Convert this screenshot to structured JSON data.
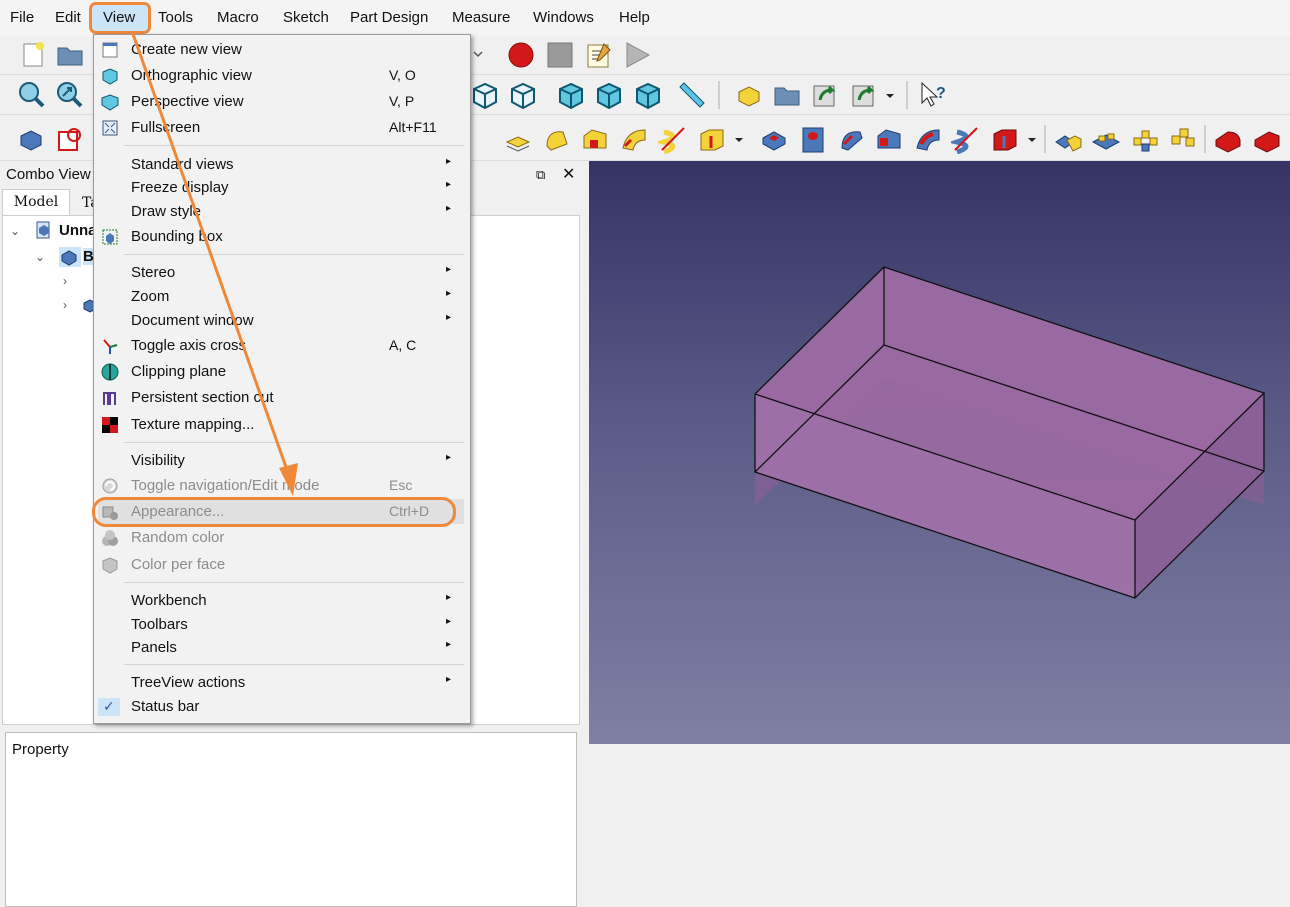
{
  "menubar": {
    "items": [
      "File",
      "Edit",
      "View",
      "Tools",
      "Macro",
      "Sketch",
      "Part Design",
      "Measure",
      "Windows",
      "Help"
    ],
    "active": "View"
  },
  "combo_view": {
    "title": "Combo View",
    "float_glyph": "⧉",
    "close_glyph": "✕",
    "tabs": [
      "Model",
      "Ta"
    ],
    "tree": [
      {
        "label": "Unna",
        "expanded": true
      },
      {
        "label": "B",
        "expanded": true
      }
    ],
    "property_header": "Property"
  },
  "view_menu": {
    "items": [
      {
        "label": "Create new view",
        "shortcut": "",
        "submenu": false,
        "enabled": true,
        "icon": "new-view-icon"
      },
      {
        "label": "Orthographic view",
        "shortcut": "V, O",
        "submenu": false,
        "enabled": true,
        "icon": "orthographic-cube-icon"
      },
      {
        "label": "Perspective view",
        "shortcut": "V, P",
        "submenu": false,
        "enabled": true,
        "icon": "perspective-cube-icon"
      },
      {
        "label": "Fullscreen",
        "shortcut": "Alt+F11",
        "submenu": false,
        "enabled": true,
        "icon": "fullscreen-icon"
      },
      {
        "label": "Standard views",
        "shortcut": "",
        "submenu": true,
        "enabled": true,
        "icon": ""
      },
      {
        "label": "Freeze display",
        "shortcut": "",
        "submenu": true,
        "enabled": true,
        "icon": ""
      },
      {
        "label": "Draw style",
        "shortcut": "",
        "submenu": true,
        "enabled": true,
        "icon": ""
      },
      {
        "label": "Bounding box",
        "shortcut": "",
        "submenu": false,
        "enabled": true,
        "icon": "bounding-box-icon"
      },
      {
        "label": "Stereo",
        "shortcut": "",
        "submenu": true,
        "enabled": true,
        "icon": ""
      },
      {
        "label": "Zoom",
        "shortcut": "",
        "submenu": true,
        "enabled": true,
        "icon": ""
      },
      {
        "label": "Document window",
        "shortcut": "",
        "submenu": true,
        "enabled": true,
        "icon": ""
      },
      {
        "label": "Toggle axis cross",
        "shortcut": "A, C",
        "submenu": false,
        "enabled": true,
        "icon": "axis-cross-icon"
      },
      {
        "label": "Clipping plane",
        "shortcut": "",
        "submenu": false,
        "enabled": true,
        "icon": "clipping-plane-icon"
      },
      {
        "label": "Persistent section cut",
        "shortcut": "",
        "submenu": false,
        "enabled": true,
        "icon": "section-cut-icon"
      },
      {
        "label": "Texture mapping...",
        "shortcut": "",
        "submenu": false,
        "enabled": true,
        "icon": "texture-icon"
      },
      {
        "label": "Visibility",
        "shortcut": "",
        "submenu": true,
        "enabled": true,
        "icon": ""
      },
      {
        "label": "Toggle navigation/Edit mode",
        "shortcut": "Esc",
        "submenu": false,
        "enabled": false,
        "icon": "navigation-mode-icon"
      },
      {
        "label": "Appearance...",
        "shortcut": "Ctrl+D",
        "submenu": false,
        "enabled": false,
        "icon": "appearance-icon"
      },
      {
        "label": "Random color",
        "shortcut": "",
        "submenu": false,
        "enabled": false,
        "icon": "random-color-icon"
      },
      {
        "label": "Color per face",
        "shortcut": "",
        "submenu": false,
        "enabled": false,
        "icon": "color-per-face-icon"
      },
      {
        "label": "Workbench",
        "shortcut": "",
        "submenu": true,
        "enabled": true,
        "icon": ""
      },
      {
        "label": "Toolbars",
        "shortcut": "",
        "submenu": true,
        "enabled": true,
        "icon": ""
      },
      {
        "label": "Panels",
        "shortcut": "",
        "submenu": true,
        "enabled": true,
        "icon": ""
      },
      {
        "label": "TreeView actions",
        "shortcut": "",
        "submenu": true,
        "enabled": true,
        "icon": ""
      },
      {
        "label": "Status bar",
        "shortcut": "",
        "submenu": false,
        "enabled": true,
        "checked": true,
        "icon": "checkmark-icon"
      }
    ],
    "submenu_glyph": "▸",
    "check_glyph": "✓"
  },
  "colors": {
    "highlight_orange": "#f0883a",
    "box_face": "#a06fa8",
    "view_top": "#333366",
    "view_bottom": "#8080a4"
  }
}
